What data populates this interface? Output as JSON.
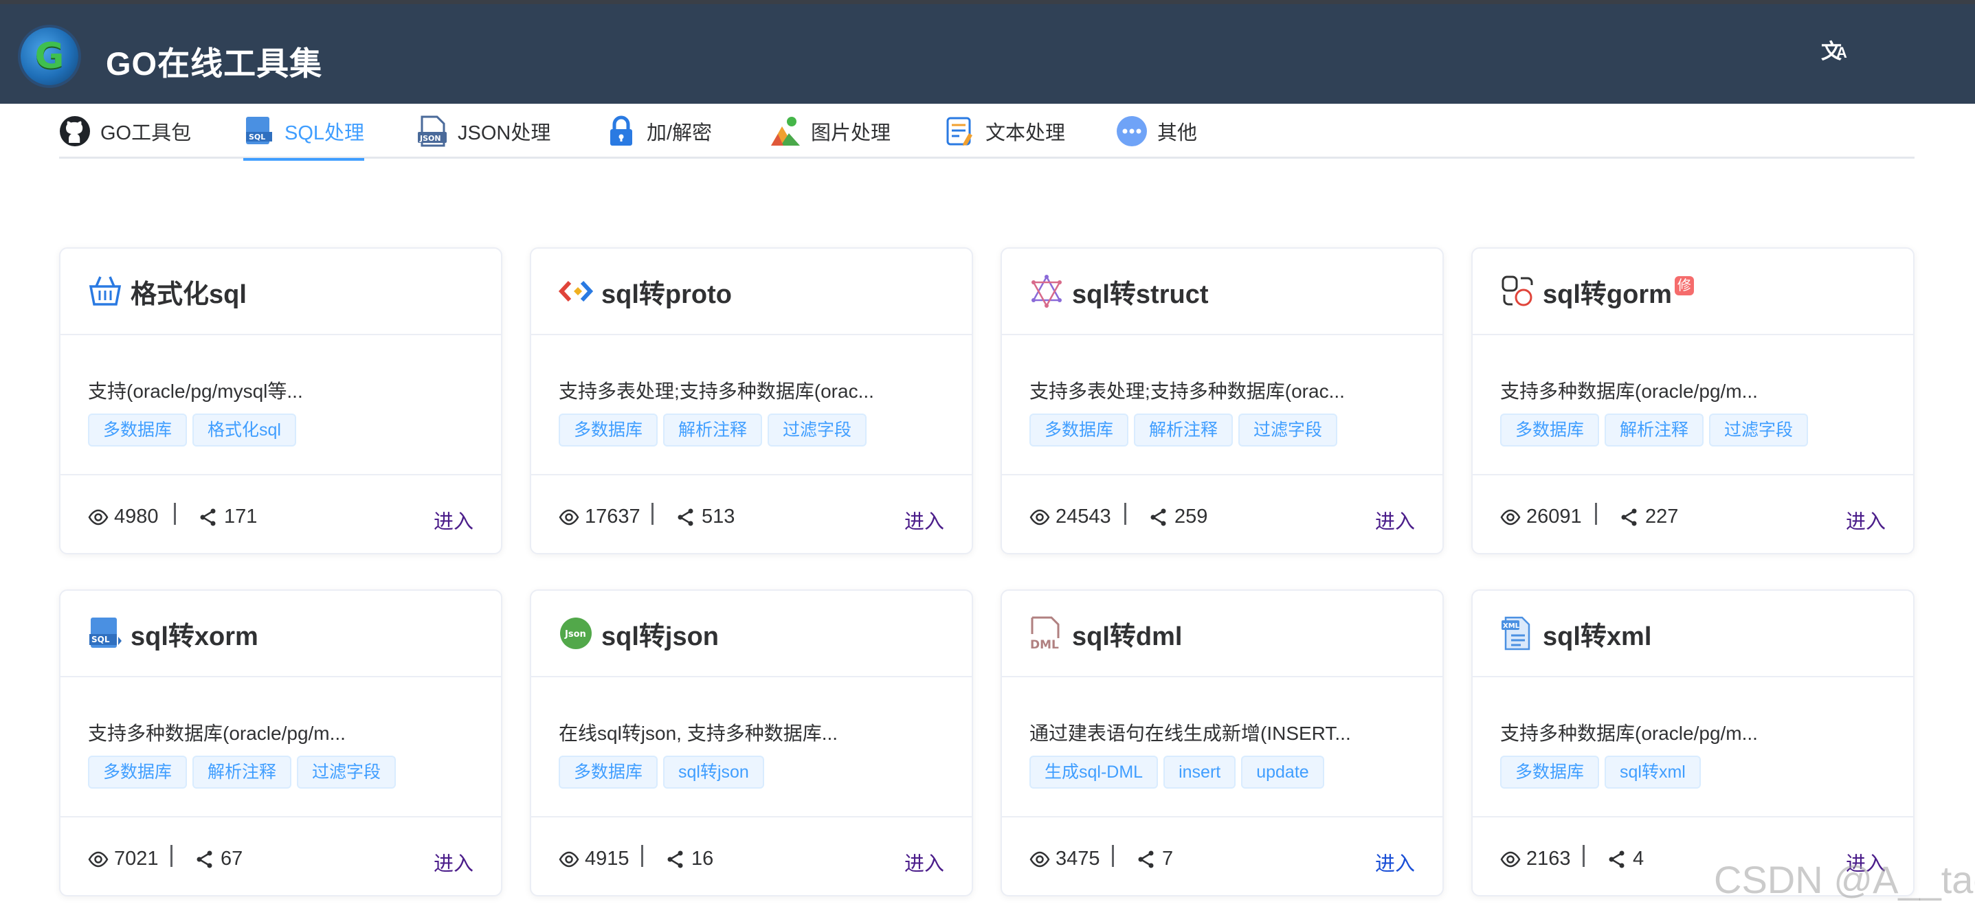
{
  "app": {
    "title": "GO在线工具集",
    "logo_letter": "G",
    "translate_glyph_a": "文",
    "translate_glyph_b": "A"
  },
  "tabs": [
    {
      "label": "GO工具包",
      "icon": "github-icon",
      "active": false
    },
    {
      "label": "SQL处理",
      "icon": "sql-file-icon",
      "active": true
    },
    {
      "label": "JSON处理",
      "icon": "json-file-icon",
      "active": false
    },
    {
      "label": "加/解密",
      "icon": "lock-icon",
      "active": false
    },
    {
      "label": "图片处理",
      "icon": "image-icon",
      "active": false
    },
    {
      "label": "文本处理",
      "icon": "text-doc-icon",
      "active": false
    },
    {
      "label": "其他",
      "icon": "more-icon",
      "active": false
    }
  ],
  "cards": [
    {
      "title": "格式化sql",
      "icon": "basket-icon",
      "desc": "支持(oracle/pg/mysql等...",
      "tags": [
        "多数据库",
        "格式化sql"
      ],
      "views": "4980",
      "shares": "171",
      "enter": "进入"
    },
    {
      "title": "sql转proto",
      "icon": "proto-icon",
      "desc": "支持多表处理;支持多种数据库(orac...",
      "tags": [
        "多数据库",
        "解析注释",
        "过滤字段"
      ],
      "views": "17637",
      "shares": "513",
      "enter": "进入"
    },
    {
      "title": "sql转struct",
      "icon": "star-icon",
      "desc": "支持多表处理;支持多种数据库(orac...",
      "tags": [
        "多数据库",
        "解析注释",
        "过滤字段"
      ],
      "views": "24543",
      "shares": "259",
      "enter": "进入"
    },
    {
      "title": "sql转gorm",
      "icon": "shapes-icon",
      "badge": "修",
      "desc": "支持多种数据库(oracle/pg/m...",
      "tags": [
        "多数据库",
        "解析注释",
        "过滤字段"
      ],
      "views": "26091",
      "shares": "227",
      "enter": "进入"
    },
    {
      "title": "sql转xorm",
      "icon": "sql-file-icon",
      "desc": "支持多种数据库(oracle/pg/m...",
      "tags": [
        "多数据库",
        "解析注释",
        "过滤字段"
      ],
      "views": "7021",
      "shares": "67",
      "enter": "进入"
    },
    {
      "title": "sql转json",
      "icon": "json-circle-icon",
      "desc": "在线sql转json, 支持多种数据库...",
      "tags": [
        "多数据库",
        "sql转json"
      ],
      "views": "4915",
      "shares": "16",
      "enter": "进入"
    },
    {
      "title": "sql转dml",
      "icon": "dml-icon",
      "desc": "通过建表语句在线生成新增(INSERT...",
      "tags": [
        "生成sql-DML",
        "insert",
        "update"
      ],
      "views": "3475",
      "shares": "7",
      "enter": "进入"
    },
    {
      "title": "sql转xml",
      "icon": "xml-file-icon",
      "desc": "支持多种数据库(oracle/pg/m...",
      "tags": [
        "多数据库",
        "sql转xml"
      ],
      "views": "2163",
      "shares": "4",
      "enter": "进入"
    }
  ],
  "icon_labels": {
    "sql": "SQL",
    "json": "JSON",
    "json_circle": "Json",
    "dml": "DML",
    "xml": "XML"
  },
  "watermark": "CSDN @A__tao"
}
